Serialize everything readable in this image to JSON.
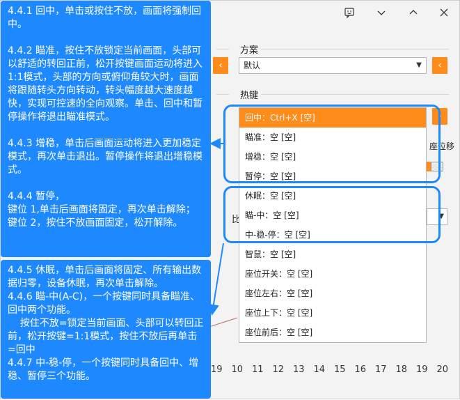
{
  "window": {
    "icons": [
      "feedback-icon",
      "minimize-icon",
      "close-icon"
    ]
  },
  "panel": {
    "scheme_label": "方案",
    "scheme_value": "默认",
    "hotkey_label": "热键",
    "hotkey_value": "回中：Ctrl+X [空]",
    "seat_fragment": "座位移",
    "compare_fragment": "比"
  },
  "dropdown": {
    "items": [
      "回中：Ctrl+X [空]",
      "瞄准：空 [空]",
      "增稳：空 [空]",
      "暂停：空 [空]",
      "休眠：空 [空]",
      "瞄-中：空 [空]",
      "中-稳-停：空 [空]",
      "智鼠：空 [空]",
      "座位开关：空 [空]",
      "座位左右：空 [空]",
      "座位上下：空 [空]",
      "座位前后：空 [空]"
    ],
    "selected_index": 0
  },
  "axis": {
    "ticks": [
      "19",
      "10",
      "11",
      "12",
      "13",
      "14",
      "15",
      "16",
      "17",
      "18",
      "19",
      "20"
    ]
  },
  "notes": {
    "note1": "4.4.1 回中，单击或按住不放，画面将强制回中。\n\n4.4.2 瞄准，按住不放锁定当前画面，头部可以舒适的转回正前，松开按键画面运动将进入1:1模式，头部的方向或俯仰角较大时，画面将跟随转头方向转动，转头幅度越大速度越快，实现可控速的全向观察。单击、回中和暂停操作将退出瞄准模式。\n\n4.4.3 增稳，单击后画面运动将进入更加稳定模式，再次单击退出。暂停操作将退出增稳模式。\n\n4.4.4 暂停，\n键位 1,单击后画面将固定，再次单击解除；\n键位 2，按住不放画面固定，松开解除。",
    "note2": "4.4.5 休眠，单击后画面将固定、所有输出数据归零，设备休眠，再次单击解除。\n4.4.6 瞄-中(A-C)，一个按键同时具备瞄准、回中两个功能。\n    按住不放=锁定当前画面、头部可以转回正前，松开按键=1:1模式，按住不放后再单击=回中\n4.4.7 中-稳-停，一个按键同时具备回中、增稳、暂停三个功能。"
  },
  "colors": {
    "accent": "#ff8c1a",
    "annotation_blue": "#1e88ff"
  }
}
